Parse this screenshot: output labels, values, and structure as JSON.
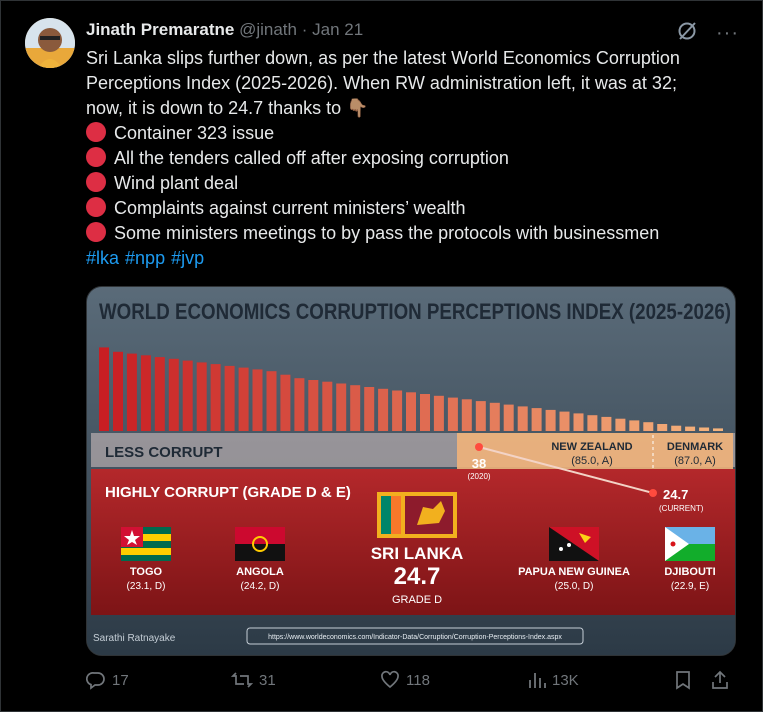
{
  "tweet": {
    "author_name": "Jinath Premaratne",
    "handle": "@jinath",
    "separator": "·",
    "date": "Jan 21",
    "text_lines": [
      "Sri Lanka slips further down, as per the latest World Economics Corruption",
      "Perceptions Index (2025-2026). When RW administration left, it was at 32;",
      "now, it is down to 24.7 thanks to"
    ],
    "pointing_emoji": "👇🏽",
    "bullets": [
      "Container 323 issue",
      "All the tenders called off after exposing corruption",
      "Wind plant deal",
      "Complaints against current ministers’ wealth",
      "Some ministers meetings to by pass the protocols with businessmen"
    ],
    "hashtags": [
      "#lka",
      "#npp",
      "#jvp"
    ]
  },
  "infographic": {
    "title": "WORLD ECONOMICS CORRUPTION PERCEPTIONS INDEX (2025-2026)",
    "less_corrupt_label": "LESS CORRUPT",
    "highly_corrupt_label": "HIGHLY CORRUPT (GRADE D & E)",
    "new_zealand": {
      "name": "NEW ZEALAND",
      "value": "(85.0, A)"
    },
    "denmark": {
      "name": "DENMARK",
      "value": "(87.0, A)"
    },
    "past_score": "38",
    "past_year": "(2020)",
    "current_score": "24.7",
    "current_label": "(CURRENT)",
    "sri_lanka": {
      "name": "SRI LANKA",
      "score": "24.7",
      "grade": "GRADE D"
    },
    "countries": [
      {
        "name": "TOGO",
        "value": "(23.1, D)"
      },
      {
        "name": "ANGOLA",
        "value": "(24.2, D)"
      },
      {
        "name": "PAPUA NEW GUINEA",
        "value": "(25.0, D)"
      },
      {
        "name": "DJIBOUTI",
        "value": "(22.9, E)"
      }
    ],
    "credit": "Sarathi Ratnayake",
    "url": "https://www.worldeconomics.com/Indicator-Data/Corruption/Corruption-Perceptions-Index.aspx",
    "bar_fills": [
      0.95,
      0.9,
      0.88,
      0.86,
      0.84,
      0.82,
      0.8,
      0.78,
      0.76,
      0.74,
      0.72,
      0.7,
      0.68,
      0.64,
      0.6,
      0.58,
      0.56,
      0.54,
      0.52,
      0.5,
      0.48,
      0.46,
      0.44,
      0.42,
      0.4,
      0.38,
      0.36,
      0.34,
      0.32,
      0.3,
      0.28,
      0.26,
      0.24,
      0.22,
      0.2,
      0.18,
      0.16,
      0.14,
      0.12,
      0.1,
      0.08,
      0.06,
      0.05,
      0.04,
      0.03
    ]
  },
  "actions": {
    "replies": "17",
    "reposts": "31",
    "likes": "118",
    "views": "13K"
  },
  "colors": {
    "background": "#000000",
    "text": "#e7e9ea",
    "muted": "#71767b",
    "link": "#1d9bf0",
    "bullet": "#dd2e44",
    "panel_red": "#9e1b1e"
  }
}
